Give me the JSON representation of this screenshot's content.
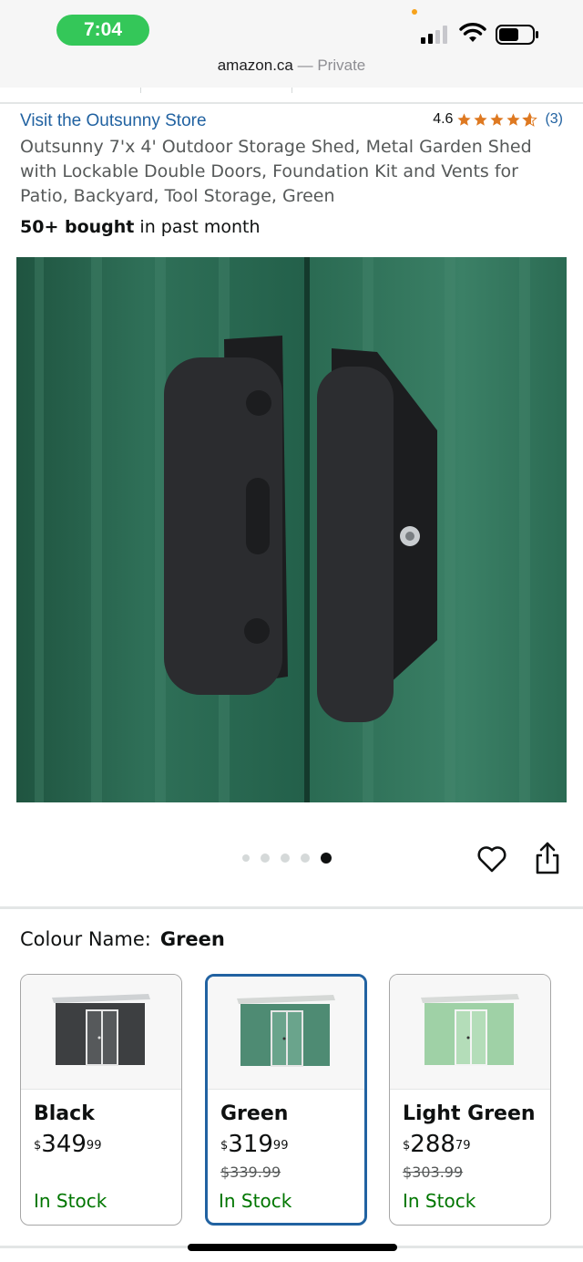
{
  "status_bar": {
    "time": "7:04",
    "icons": [
      "signal-icon",
      "wifi-icon",
      "battery-icon"
    ]
  },
  "url_bar": {
    "domain": "amazon.ca",
    "separator": " — ",
    "mode": "Private"
  },
  "product": {
    "store_link": "Visit the Outsunny Store",
    "rating_value": "4.6",
    "rating_stars": 4.6,
    "rating_count": "(3)",
    "title": "Outsunny 7'x 4' Outdoor Storage Shed, Metal Garden Shed with Lockable Double Doors, Foundation Kit and Vents for Patio, Backyard, Tool Storage, Green",
    "bought_bold": "50+ bought",
    "bought_rest": " in past month"
  },
  "carousel": {
    "total_images": 5,
    "active_index": 4,
    "actions": [
      "heart-icon",
      "share-icon"
    ]
  },
  "variants": {
    "label": "Colour Name:",
    "selected_value": "Green",
    "options": [
      {
        "name": "Black",
        "price_whole": "349",
        "price_fraction": "99",
        "currency": "$",
        "was_price": "",
        "stock": "In Stock",
        "shed_color": "#3d3f41",
        "selected": false
      },
      {
        "name": "Green",
        "price_whole": "319",
        "price_fraction": "99",
        "currency": "$",
        "was_price": "$339.99",
        "stock": "In Stock",
        "shed_color": "#4e8b73",
        "selected": true
      },
      {
        "name": "Light Green",
        "price_whole": "288",
        "price_fraction": "79",
        "currency": "$",
        "was_price": "$303.99",
        "stock": "In Stock",
        "shed_color": "#9fd1a6",
        "selected": false
      }
    ]
  },
  "colors": {
    "link_blue": "#2162a1",
    "star_orange": "#de7921",
    "in_stock_green": "#007600",
    "time_pill_green": "#34c759"
  }
}
